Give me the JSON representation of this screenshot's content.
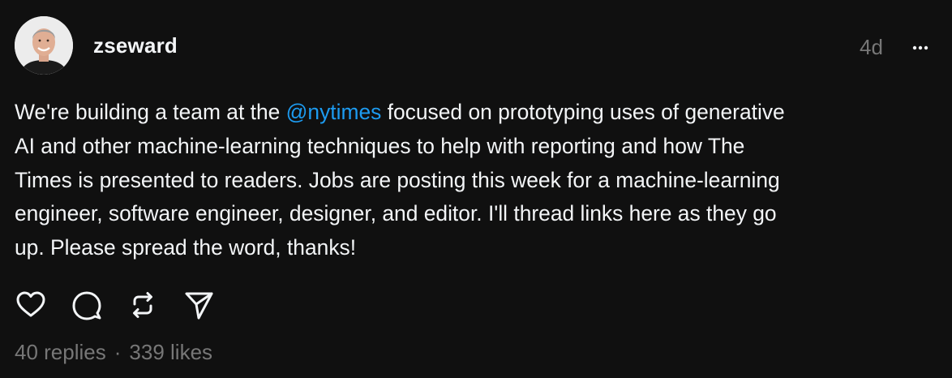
{
  "post": {
    "username": "zseward",
    "timestamp": "4d",
    "more_icon": "more-horizontal-icon",
    "text_lines": [
      {
        "before": "We're building a team at the ",
        "mention": "@nytimes",
        "after": " focused on prototyping uses of generative"
      },
      {
        "text": "AI and other machine-learning techniques to help with reporting and how The"
      },
      {
        "text": "Times is presented to readers. Jobs are posting this week for a machine-learning"
      },
      {
        "text": "engineer, software engineer, designer, and editor. I'll thread links here as they go"
      },
      {
        "text": "up. Please spread the word, thanks!"
      }
    ],
    "actions": [
      {
        "name": "like",
        "icon": "heart-icon"
      },
      {
        "name": "reply",
        "icon": "comment-icon"
      },
      {
        "name": "repost",
        "icon": "repost-icon"
      },
      {
        "name": "share",
        "icon": "send-icon"
      }
    ],
    "stats": {
      "replies": "40 replies",
      "separator": "·",
      "likes": "339 likes"
    }
  },
  "colors": {
    "background": "#101010",
    "text": "#f3f5f7",
    "muted": "#777777",
    "mention": "#1d9bf0"
  }
}
